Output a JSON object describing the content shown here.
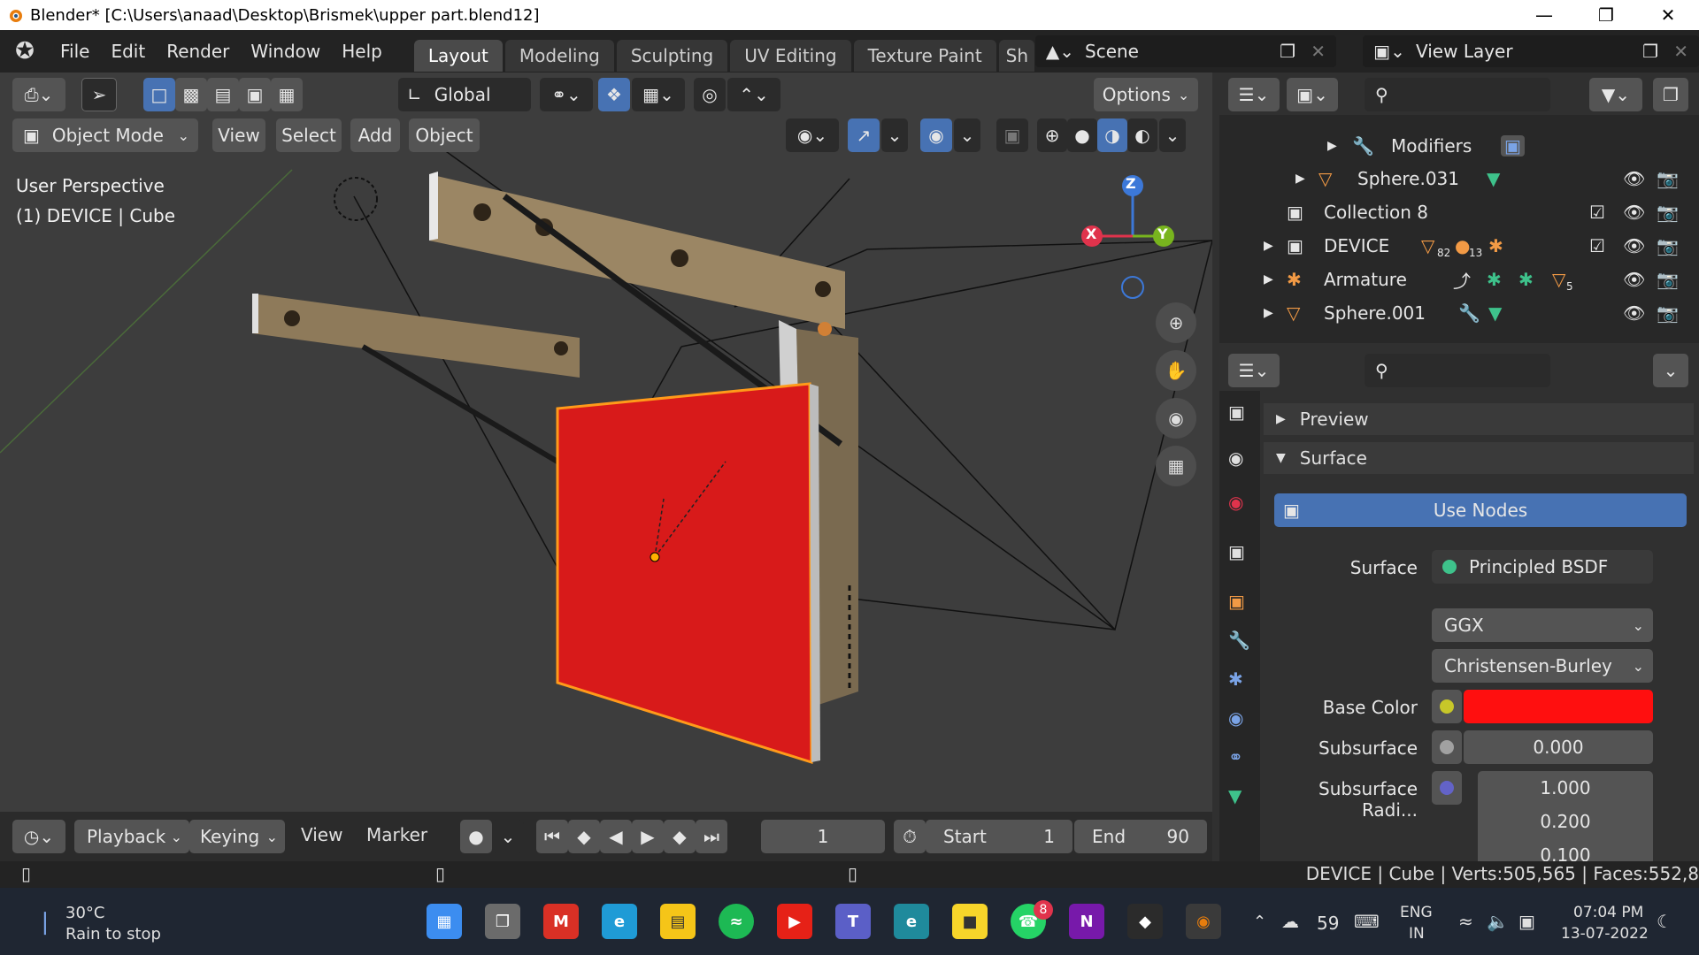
{
  "window": {
    "title": "Blender* [C:\\Users\\anaad\\Desktop\\Brismek\\upper part.blend12]"
  },
  "menu": [
    "File",
    "Edit",
    "Render",
    "Window",
    "Help"
  ],
  "workspaces": [
    "Layout",
    "Modeling",
    "Sculpting",
    "UV Editing",
    "Texture Paint",
    "Sh"
  ],
  "scene": {
    "scene_name": "Scene",
    "view_layer": "View Layer"
  },
  "viewport": {
    "transform_orientation": "Global",
    "options_label": "Options",
    "mode": "Object Mode",
    "header_menus": [
      "View",
      "Select",
      "Add",
      "Object"
    ],
    "perspective_text": "User Perspective",
    "object_text": "(1) DEVICE | Cube",
    "gizmo": {
      "x": "X",
      "y": "Y",
      "z": "Z"
    }
  },
  "outliner": {
    "rows": [
      {
        "label": "Modifiers"
      },
      {
        "label": "Sphere.031"
      },
      {
        "label": "Collection 8"
      },
      {
        "label": "DEVICE",
        "badge1": "82",
        "badge2": "13"
      },
      {
        "label": "Armature",
        "badge1": "5"
      },
      {
        "label": "Sphere.001"
      }
    ]
  },
  "properties": {
    "preview": "Preview",
    "surface_panel": "Surface",
    "use_nodes": "Use Nodes",
    "surface_label": "Surface",
    "surface_value": "Principled BSDF",
    "distribution": "GGX",
    "subsurface_method": "Christensen-Burley",
    "base_color_label": "Base Color",
    "subsurface_label": "Subsurface",
    "subsurface_value": "0.000",
    "subsurface_radius_label": "Subsurface Radi...",
    "radius_values": [
      "1.000",
      "0.200",
      "0.100"
    ],
    "base_color_hex": "#ff0f0f"
  },
  "timeline": {
    "menus": [
      "Playback",
      "Keying",
      "View",
      "Marker"
    ],
    "current_frame": "1",
    "start_label": "Start",
    "start_value": "1",
    "end_label": "End",
    "end_value": "90"
  },
  "status": {
    "text": "DEVICE | Cube | Verts:505,565 | Faces:552,8"
  },
  "taskbar": {
    "weather_temp": "30°C",
    "weather_text": "Rain to stop",
    "whatsapp_badge": "8",
    "aqi": "59",
    "lang": "ENG",
    "region": "IN",
    "time": "07:04 PM",
    "date": "13-07-2022"
  }
}
